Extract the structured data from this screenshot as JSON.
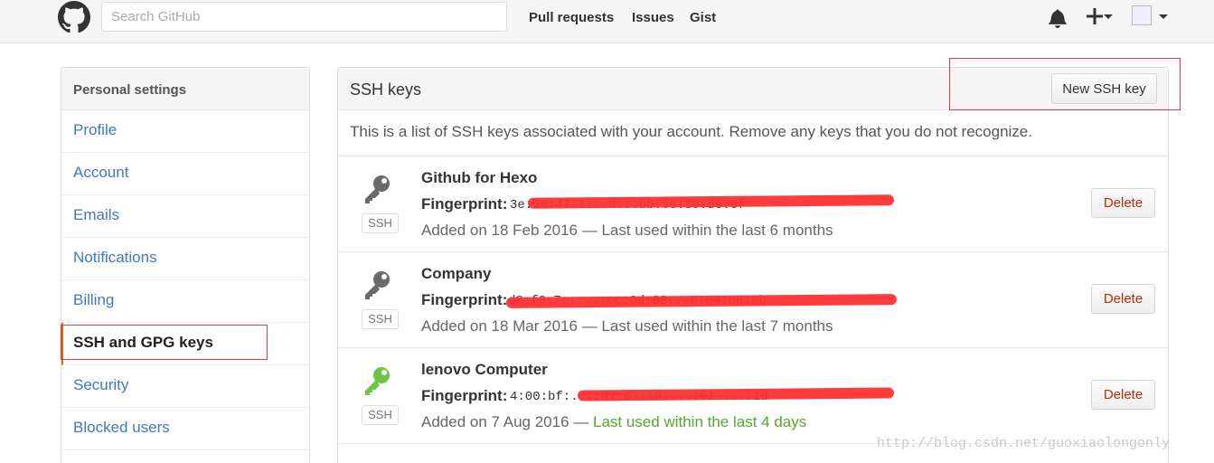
{
  "header": {
    "search_placeholder": "Search GitHub",
    "nav": [
      "Pull requests",
      "Issues",
      "Gist"
    ],
    "icons": [
      "github-logo",
      "bell-icon",
      "plus-icon",
      "avatar"
    ]
  },
  "sidebar": {
    "title": "Personal settings",
    "items": [
      {
        "label": "Profile"
      },
      {
        "label": "Account"
      },
      {
        "label": "Emails"
      },
      {
        "label": "Notifications"
      },
      {
        "label": "Billing"
      },
      {
        "label": "SSH and GPG keys",
        "selected": true
      },
      {
        "label": "Security"
      },
      {
        "label": "Blocked users"
      }
    ]
  },
  "main": {
    "title": "SSH keys",
    "new_button": "New SSH key",
    "description": "This is a list of SSH keys associated with your account. Remove any keys that you do not recognize.",
    "fingerprint_label": "Fingerprint:",
    "badge": "SSH",
    "delete_label": "Delete",
    "keys": [
      {
        "title": "Github for Hexo",
        "fingerprint": "3e:3e:47:1...0...bb:56:39:de:6f",
        "added": "Added on 18 Feb 2016 — ",
        "last_used": "Last used within the last 6 months",
        "recent": false,
        "icon_color": "#6a6a6a"
      },
      {
        "title": "Company",
        "fingerprint": "d8:f0:7c:...:cc:0d:82...0:64:68:6b",
        "added": "Added on 18 Mar 2016 — ",
        "last_used": "Last used within the last 7 months",
        "recent": false,
        "icon_color": "#6a6a6a"
      },
      {
        "title": "lenovo Computer",
        "fingerprint": "4:00:bf:...:d7:67:10:...:01:...:1d",
        "added": "Added on 7 Aug 2016 — ",
        "last_used": "Last used within the last 4 days",
        "recent": true,
        "icon_color": "#6cc644"
      }
    ]
  },
  "watermark": "http://blog.csdn.net/guoxiaolongonly"
}
